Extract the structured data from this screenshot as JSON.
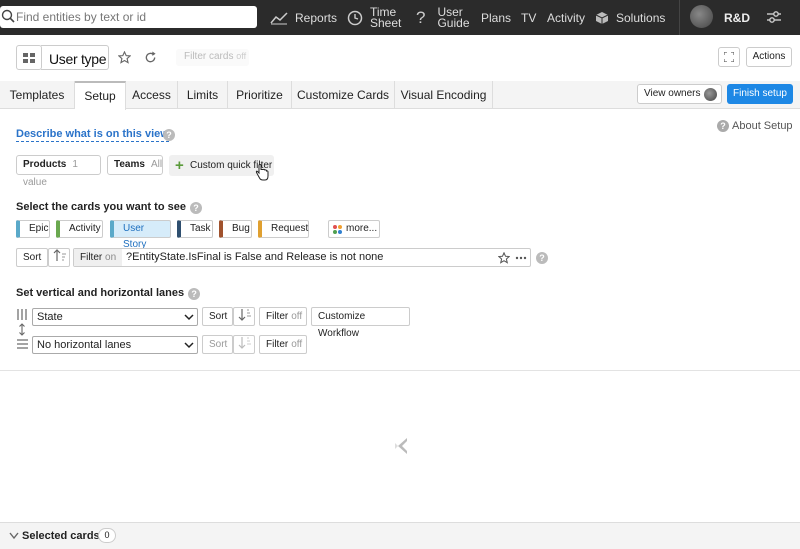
{
  "topbar": {
    "search_placeholder": "Find entities by text or id",
    "nav": [
      {
        "label": "Reports",
        "icon": "reports-icon"
      },
      {
        "label_line1": "Time",
        "label_line2": "Sheet",
        "icon": "clock-icon"
      },
      {
        "label_line1": "User",
        "label_line2": "Guide",
        "icon": "question-icon"
      },
      {
        "label": "Plans"
      },
      {
        "label": "TV"
      },
      {
        "label": "Activity"
      },
      {
        "label": "Solutions",
        "icon": "cube-icon"
      }
    ],
    "team": "R&D"
  },
  "header": {
    "view_name": "User type",
    "filter_cards": "Filter cards",
    "filter_cards_state": "off",
    "actions": "Actions"
  },
  "tabs": [
    "Templates",
    "Setup",
    "Access",
    "Limits",
    "Prioritize",
    "Customize Cards",
    "Visual Encoding"
  ],
  "active_tab": "Setup",
  "tabbar": {
    "view_owners": "View owners",
    "finish_setup": "Finish setup"
  },
  "setup": {
    "describe": "Describe what is on this view",
    "about": "About Setup",
    "quick_filters": [
      {
        "label": "Products",
        "value": "1 value"
      },
      {
        "label": "Teams",
        "value": "All"
      }
    ],
    "custom_quick_filter": "Custom quick filter",
    "cards_title": "Select the cards you want to see",
    "card_types": [
      {
        "label": "Epic",
        "color": "#5aa9c9",
        "selected": false
      },
      {
        "label": "Activity",
        "color": "#6aa84f",
        "selected": false
      },
      {
        "label": "User Story",
        "color": "#5aa9c9",
        "selected": true
      },
      {
        "label": "Task",
        "color": "#2f4f6f",
        "selected": false
      },
      {
        "label": "Bug",
        "color": "#a0522d",
        "selected": false
      },
      {
        "label": "Request",
        "color": "#e0a030",
        "selected": false
      }
    ],
    "more": "more...",
    "sort": "Sort",
    "filter": "Filter",
    "filter_state_on": "on",
    "filter_state_off": "off",
    "filter_expression": "?EntityState.IsFinal is False and Release is not none",
    "lanes_title": "Set vertical and horizontal lanes",
    "vertical_lane": "State",
    "horizontal_lane": "No horizontal lanes",
    "customize_workflow": "Customize Workflow"
  },
  "footer": {
    "label": "Selected cards",
    "count": "0"
  },
  "colors": {
    "accent": "#1e88e5",
    "link": "#2a73c9",
    "topbar": "#2b2b2b"
  }
}
